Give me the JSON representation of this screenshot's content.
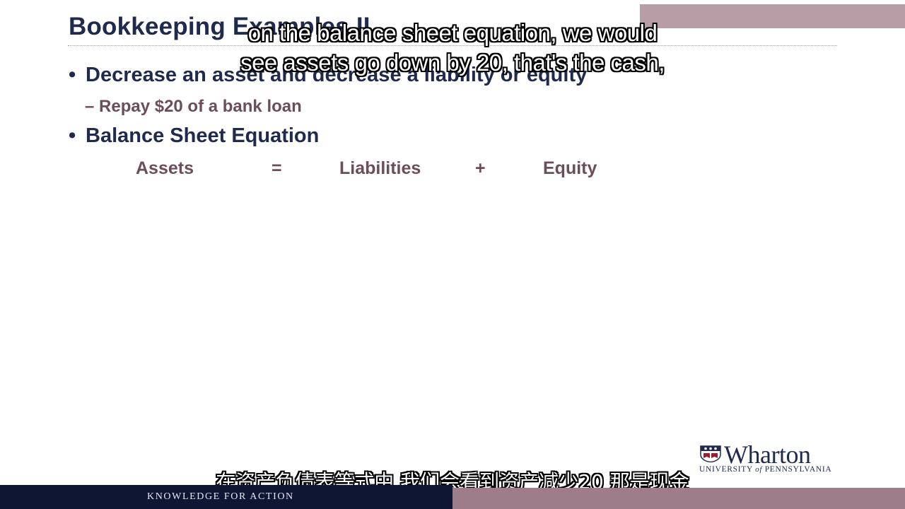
{
  "slide": {
    "title": "Bookkeeping Examples II",
    "bullets": [
      {
        "text": "Decrease an asset and decrease a liability or equity"
      },
      {
        "text": "Balance Sheet Equation"
      }
    ],
    "sub_bullet": "– Repay $20 of a bank loan",
    "equation": {
      "assets": "Assets",
      "equals": "=",
      "liabilities": "Liabilities",
      "plus": "+",
      "equity": "Equity"
    }
  },
  "captions": {
    "en_line1": "on the balance sheet equation, we would",
    "en_line2": "see assets go down by 20, that's the cash,",
    "zh": "在资产负债表等式中 我们会看到资产减少20 那是现金"
  },
  "branding": {
    "logo_word": "Wharton",
    "logo_sub_a": "UNIVERSITY",
    "logo_sub_of": "of",
    "logo_sub_b": "PENNSYLVANIA",
    "logo_icon": "penn-shield-icon",
    "tagline": "KNOWLEDGE FOR ACTION"
  },
  "colors": {
    "navy": "#1f2a4c",
    "mauve": "#6b4d5c",
    "footer_dark": "#0e1633",
    "footer_mauve": "#9e7d8b"
  }
}
